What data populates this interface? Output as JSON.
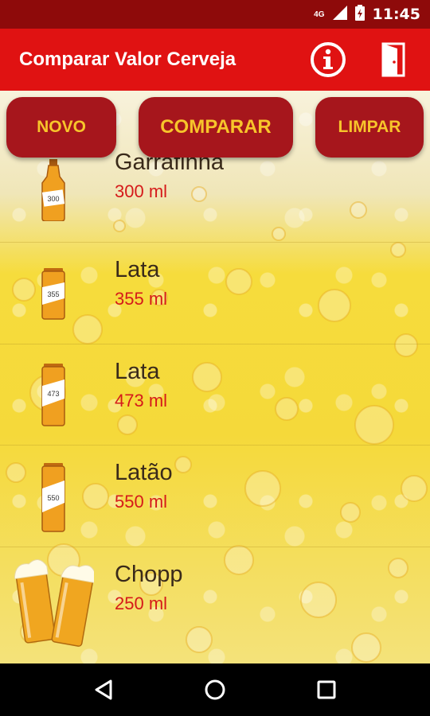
{
  "status_bar": {
    "network": "4G",
    "time": "11:45",
    "icons": [
      "signal-icon",
      "battery-charging-icon"
    ]
  },
  "app_bar": {
    "title": "Comparar Valor Cerveja",
    "actions": [
      {
        "name": "info-icon"
      },
      {
        "name": "exit-door-icon"
      }
    ]
  },
  "buttons": {
    "novo": "NOVO",
    "comparar": "COMPARAR",
    "limpar": "LIMPAR"
  },
  "items": [
    {
      "title": "Garrafinha",
      "subtitle": "300 ml",
      "icon": "bottle-icon",
      "tag": "300"
    },
    {
      "title": "Lata",
      "subtitle": "355 ml",
      "icon": "can-icon",
      "tag": "355"
    },
    {
      "title": "Lata",
      "subtitle": "473 ml",
      "icon": "can-icon",
      "tag": "473"
    },
    {
      "title": "Latão",
      "subtitle": "550 ml",
      "icon": "can-icon",
      "tag": "550"
    },
    {
      "title": "Chopp",
      "subtitle": "250 ml",
      "icon": "beer-glasses-icon",
      "tag": ""
    }
  ],
  "nav": [
    "back-icon",
    "home-icon",
    "recents-icon"
  ],
  "colors": {
    "status_bar": "#8e0a0a",
    "app_bar": "#e01212",
    "button_bg": "#a6161c",
    "button_text": "#f7c52b",
    "subtitle": "#d51a1a"
  }
}
